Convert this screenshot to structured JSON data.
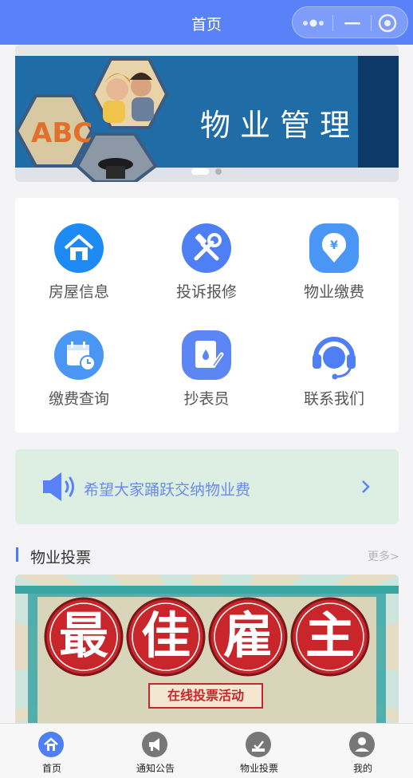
{
  "navbar": {
    "title": "首页"
  },
  "banner": {
    "headline": "物业管理",
    "slide_count": 2,
    "active_slide": 1
  },
  "menu": {
    "items": [
      {
        "label": "房屋信息",
        "icon": "house-icon",
        "color": "#1e8bf5"
      },
      {
        "label": "投诉报修",
        "icon": "wrench-hammer-icon",
        "color": "#4f7ff4"
      },
      {
        "label": "物业缴费",
        "icon": "yuan-download-icon",
        "color": "#4996f4"
      },
      {
        "label": "缴费查询",
        "icon": "calendar-clock-icon",
        "color": "#4996f4"
      },
      {
        "label": "抄表员",
        "icon": "meter-pen-icon",
        "color": "#5b86f4"
      },
      {
        "label": "联系我们",
        "icon": "headset-service-icon",
        "color": "#4f7ff4"
      }
    ]
  },
  "notice": {
    "text": "希望大家踊跃交纳物业费",
    "icon": "speaker-icon"
  },
  "vote_section": {
    "title": "物业投票",
    "more": "更多>",
    "poster": {
      "characters": [
        "最",
        "佳",
        "雇",
        "主"
      ],
      "subtitle": "在线投票活动"
    }
  },
  "tabbar": {
    "items": [
      {
        "label": "首页",
        "icon": "home-icon",
        "active": true
      },
      {
        "label": "通知公告",
        "icon": "megaphone-icon",
        "active": false
      },
      {
        "label": "物业投票",
        "icon": "ballot-icon",
        "active": false
      },
      {
        "label": "我的",
        "icon": "user-icon",
        "active": false
      }
    ]
  },
  "colors": {
    "primary": "#5a82f8",
    "notice_bg": "#dcefe2",
    "poster_red": "#c8262b"
  }
}
